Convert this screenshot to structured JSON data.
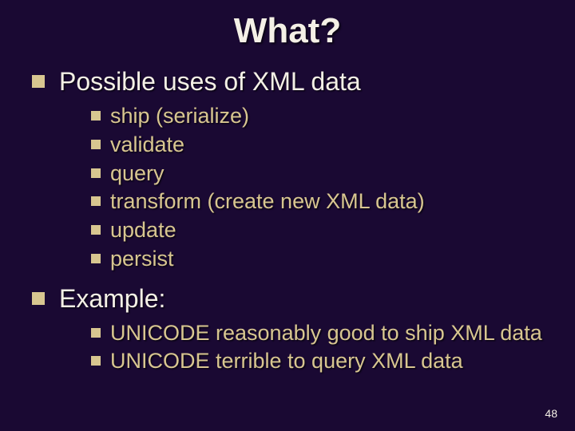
{
  "title": "What?",
  "sections": [
    {
      "heading": "Possible uses of XML data",
      "items": [
        "ship (serialize)",
        "validate",
        "query",
        "transform (create new XML data)",
        "update",
        "persist"
      ]
    },
    {
      "heading": "Example:",
      "items": [
        "UNICODE reasonably good to ship XML data",
        "UNICODE terrible to query XML data"
      ]
    }
  ],
  "page_number": "48"
}
